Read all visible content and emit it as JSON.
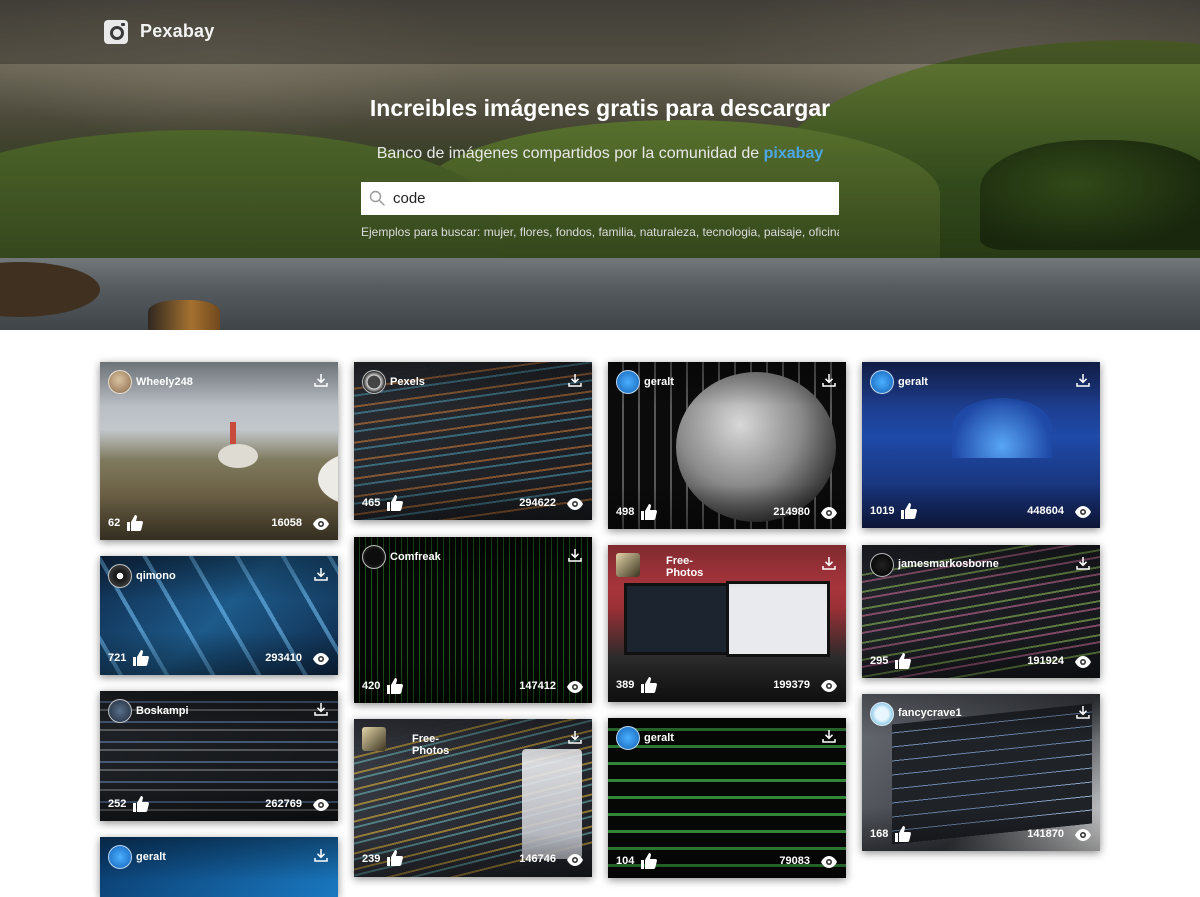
{
  "header": {
    "brand": "Pexabay",
    "title": "Increibles imágenes gratis para descargar",
    "subtitle_prefix": "Banco de imágenes compartidos por la comunidad de",
    "subtitle_link": "pixabay",
    "search": {
      "value": "code",
      "placeholder": ""
    },
    "examples": "Ejemplos para buscar: mujer, flores, fondos, familia, naturaleza, tecnologia, paisaje, oficina"
  },
  "colors": {
    "accent": "#4aa8e8",
    "card_text": "#ffffff"
  },
  "cards": [
    {
      "user": "Wheely248",
      "likes": "62",
      "views": "16058"
    },
    {
      "user": "qimono",
      "likes": "721",
      "views": "293410"
    },
    {
      "user": "Boskampi",
      "likes": "252",
      "views": "262769"
    },
    {
      "user": "geralt",
      "likes": "",
      "views": ""
    },
    {
      "user": "Pexels",
      "likes": "465",
      "views": "294622"
    },
    {
      "user": "Comfreak",
      "likes": "420",
      "views": "147412"
    },
    {
      "user": "Free-Photos",
      "likes": "239",
      "views": "146746"
    },
    {
      "user": "geralt",
      "likes": "498",
      "views": "214980"
    },
    {
      "user": "Free-Photos",
      "likes": "389",
      "views": "199379"
    },
    {
      "user": "geralt",
      "likes": "104",
      "views": "79083"
    },
    {
      "user": "geralt",
      "likes": "1019",
      "views": "448604"
    },
    {
      "user": "jamesmarkosborne",
      "likes": "295",
      "views": "191924"
    },
    {
      "user": "fancycrave1",
      "likes": "168",
      "views": "141870"
    }
  ],
  "icons": {
    "logo": "camera-icon",
    "search": "search-icon",
    "download": "download-icon",
    "like": "thumbs-up-icon",
    "views": "eye-icon"
  }
}
